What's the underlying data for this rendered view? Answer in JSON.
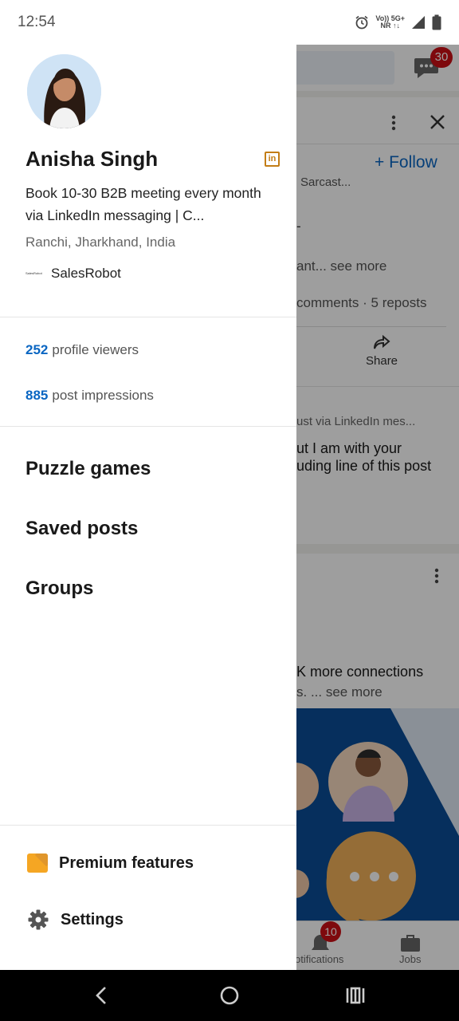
{
  "status_bar": {
    "time": "12:54",
    "icons": [
      "alarm-icon",
      "volte-icon",
      "5g-icon",
      "signal-icon",
      "battery-icon"
    ],
    "network_top": "Vo)) 5G+",
    "network_bottom": "NR  ↑↓"
  },
  "background": {
    "messages_badge": "30",
    "follow_label": "+ Follow",
    "post_author_snippet": "Sarcast...",
    "post_text_snippet": "ant... see more",
    "post_stats": "comments · 5 reposts",
    "share_label": "Share",
    "headline_snippet": "ust via LinkedIn mes...",
    "body_line1": "ut I am with your",
    "body_line2": "uding line of this post",
    "card2_line1": "K more connections",
    "card2_line2": "s. ... see more",
    "notifications_label": "otifications",
    "notifications_badge": "10",
    "jobs_label": "Jobs"
  },
  "drawer": {
    "profile": {
      "name": "Anisha Singh",
      "headline": "Book 10-30 B2B meeting every month via LinkedIn messaging | C...",
      "location": "Ranchi, Jharkhand, India",
      "company": "SalesRobot",
      "company_logo_text": "SalesRobot",
      "linkedin_badge": "in"
    },
    "stats": [
      {
        "value": "252",
        "label": "profile viewers"
      },
      {
        "value": "885",
        "label": "post impressions"
      }
    ],
    "menu": [
      {
        "label": "Puzzle games"
      },
      {
        "label": "Saved posts"
      },
      {
        "label": "Groups"
      }
    ],
    "bottom": {
      "premium_label": "Premium features",
      "settings_label": "Settings"
    }
  },
  "colors": {
    "accent": "#0a66c2",
    "premium": "#f5a623",
    "linkedin_badge": "#c37d16",
    "badge_red": "#cc1016"
  }
}
